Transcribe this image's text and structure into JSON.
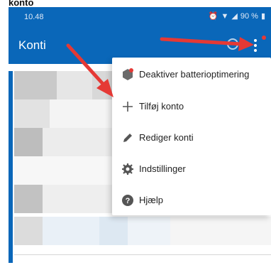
{
  "page_caption": "konto",
  "status_bar": {
    "time": "10.48",
    "battery_pct": "90 %"
  },
  "app_bar": {
    "title": "Konti"
  },
  "menu": {
    "items": [
      {
        "label": "Deaktiver batterioptimering",
        "icon": "battery-badge-icon"
      },
      {
        "label": "Tilføj konto",
        "icon": "plus-icon"
      },
      {
        "label": "Rediger konti",
        "icon": "pencil-icon"
      },
      {
        "label": "Indstillinger",
        "icon": "gear-icon"
      },
      {
        "label": "Hjælp",
        "icon": "help-icon"
      }
    ]
  },
  "colors": {
    "accent": "#0a67b9",
    "annotation_arrow": "#e53935",
    "badge": "#e53935"
  }
}
